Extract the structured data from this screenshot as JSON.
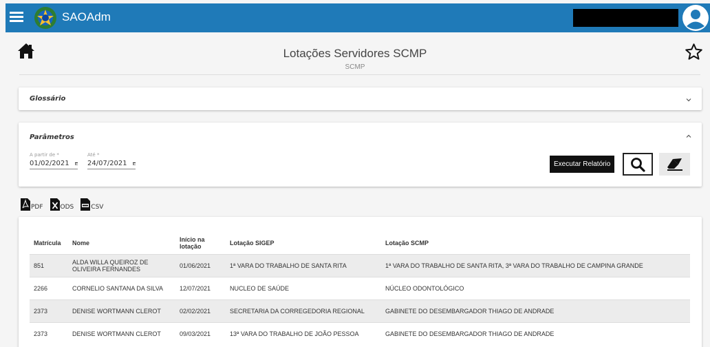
{
  "header": {
    "app_title": "SAOAdm"
  },
  "page": {
    "title": "Lotações Servidores SCMP",
    "subtitle": "SCMP"
  },
  "glossario": {
    "title": "Glossário"
  },
  "parametros": {
    "title": "Parâmetros",
    "from_label": "A partir de *",
    "from_value": "01/02/2021",
    "to_label": "Até *",
    "to_value": "24/07/2021",
    "run_label": "Executar Relatório"
  },
  "exports": {
    "pdf": "PDF",
    "ods": "ODS",
    "csv": "CSV"
  },
  "table": {
    "headers": {
      "matricula": "Matrícula",
      "nome": "Nome",
      "inicio": "Início na lotação",
      "sigep": "Lotação SIGEP",
      "scmp": "Lotação SCMP"
    },
    "rows": [
      {
        "matricula": "851",
        "nome": "ALDA WILLA QUEIROZ DE OLIVEIRA FERNANDES",
        "inicio": "01/06/2021",
        "sigep": "1ª VARA DO TRABALHO DE SANTA RITA",
        "scmp": "1ª VARA DO TRABALHO DE SANTA RITA, 3ª VARA DO TRABALHO DE CAMPINA GRANDE"
      },
      {
        "matricula": "2266",
        "nome": "CORNELIO SANTANA DA SILVA",
        "inicio": "12/07/2021",
        "sigep": "NUCLEO DE SAÚDE",
        "scmp": "NÚCLEO ODONTOLÓGICO"
      },
      {
        "matricula": "2373",
        "nome": "DENISE WORTMANN CLEROT",
        "inicio": "02/02/2021",
        "sigep": "SECRETARIA DA CORREGEDORIA REGIONAL",
        "scmp": "GABINETE DO DESEMBARGADOR THIAGO DE ANDRADE"
      },
      {
        "matricula": "2373",
        "nome": "DENISE WORTMANN CLEROT",
        "inicio": "09/03/2021",
        "sigep": "13ª VARA DO TRABALHO DE JOÃO PESSOA",
        "scmp": "GABINETE DO DESEMBARGADOR THIAGO DE ANDRADE"
      }
    ]
  },
  "colors": {
    "header_bg": "#1f7ab8",
    "button_dark": "#111111",
    "row_alt": "#ececec"
  },
  "icons": {
    "menu": "hamburger-icon",
    "logo": "coat-of-arms-logo",
    "avatar": "user-avatar-icon",
    "home": "home-icon",
    "favorite": "star-outline-icon",
    "search": "search-icon",
    "clear": "eraser-icon",
    "calendar": "calendar-icon",
    "pdf": "pdf-file-icon",
    "ods": "ods-file-icon",
    "csv": "csv-file-icon"
  }
}
